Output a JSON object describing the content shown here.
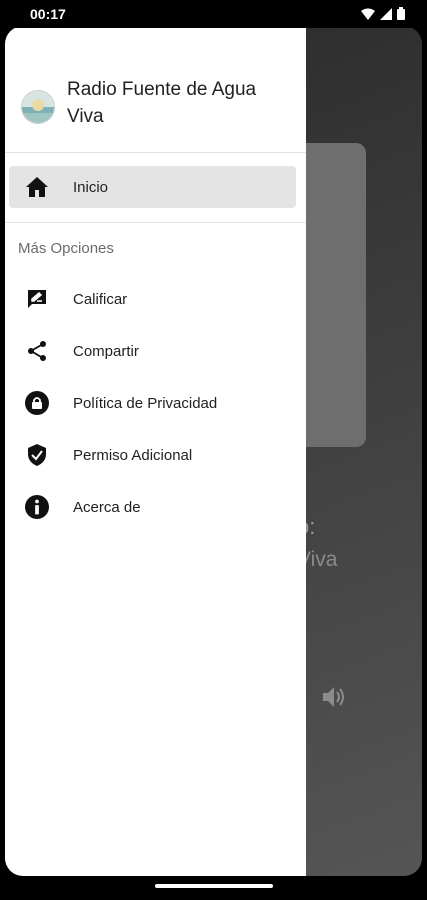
{
  "status_bar": {
    "time": "00:17"
  },
  "drawer": {
    "app_title": "Radio Fuente de Agua Viva",
    "active_item": {
      "label": "Inicio",
      "icon": "home-icon"
    },
    "section_title": "Más Opciones",
    "items": [
      {
        "label": "Calificar",
        "icon": "rate-review-icon"
      },
      {
        "label": "Compartir",
        "icon": "share-icon"
      },
      {
        "label": "Política de Privacidad",
        "icon": "lock-icon"
      },
      {
        "label": "Permiso Adicional",
        "icon": "shield-check-icon"
      },
      {
        "label": "Acerca de",
        "icon": "info-icon"
      }
    ]
  },
  "background": {
    "now_playing_label_partial": "o:",
    "station_partial": "Viva"
  },
  "colors": {
    "drawer_bg": "#ffffff",
    "active_item_bg": "#e4e4e4",
    "text": "#222222",
    "section_title": "#6b6b6b"
  }
}
